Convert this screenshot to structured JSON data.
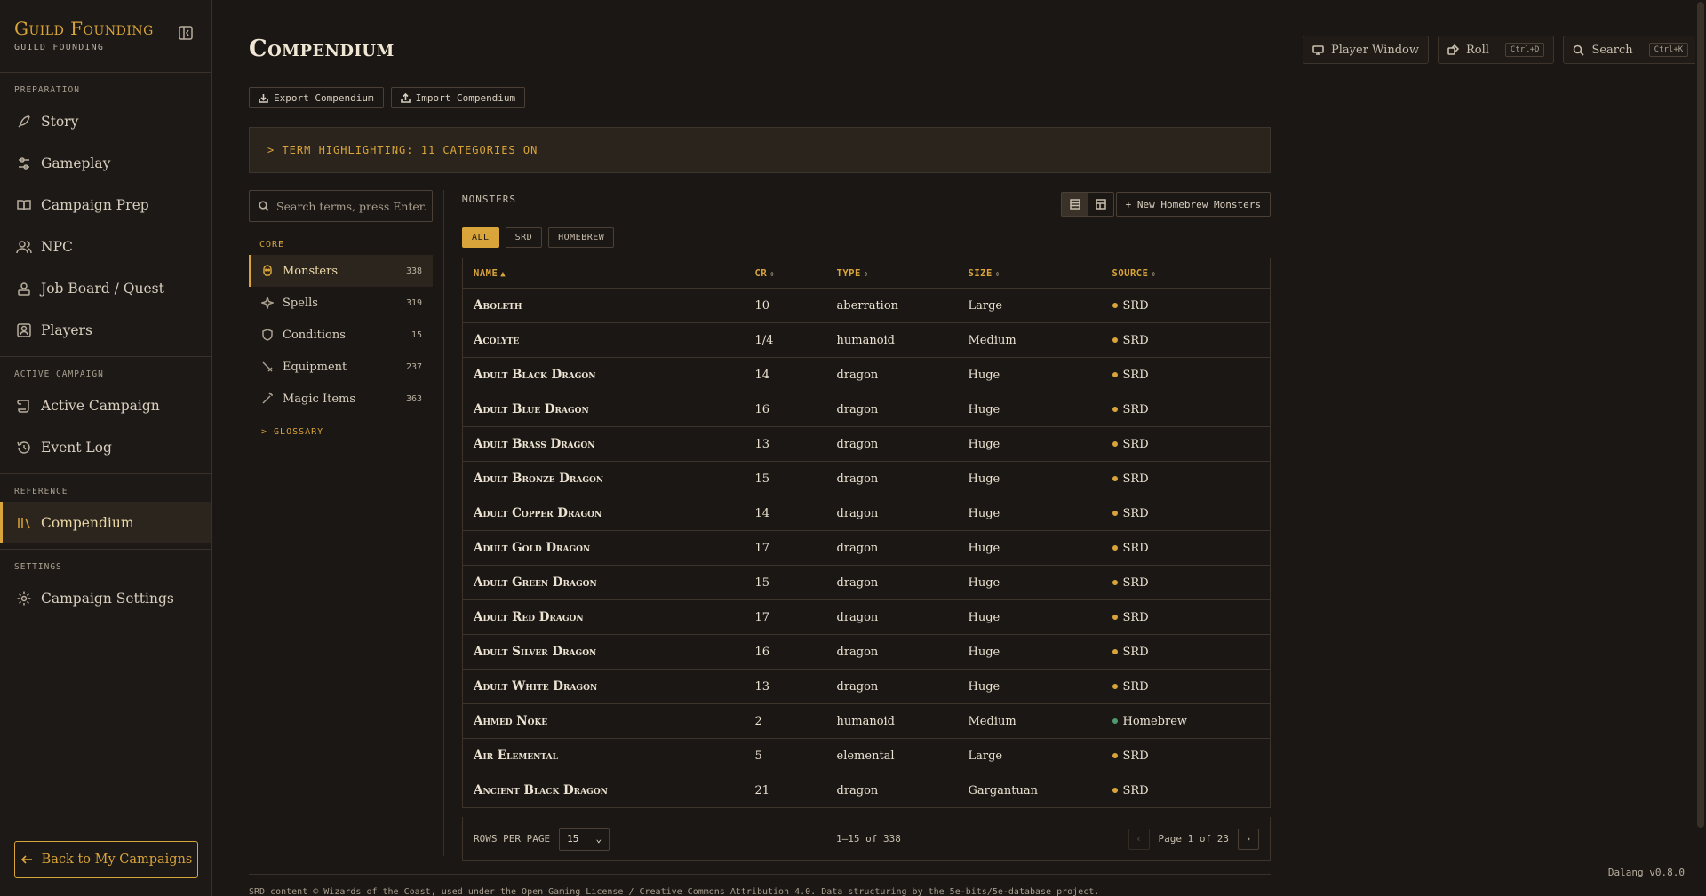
{
  "brand": {
    "title": "Guild Founding",
    "subtitle": "GUILD FOUNDING"
  },
  "sidebar": {
    "sections": [
      {
        "label": "PREPARATION",
        "items": [
          {
            "label": "Story",
            "icon": "feather-icon"
          },
          {
            "label": "Gameplay",
            "icon": "sliders-icon"
          },
          {
            "label": "Campaign Prep",
            "icon": "book-icon"
          },
          {
            "label": "NPC",
            "icon": "users-icon"
          },
          {
            "label": "Job Board / Quest",
            "icon": "quest-icon"
          },
          {
            "label": "Players",
            "icon": "player-icon"
          }
        ]
      },
      {
        "label": "ACTIVE CAMPAIGN",
        "items": [
          {
            "label": "Active Campaign",
            "icon": "scroll-icon"
          },
          {
            "label": "Event Log",
            "icon": "history-icon"
          }
        ]
      },
      {
        "label": "REFERENCE",
        "items": [
          {
            "label": "Compendium",
            "icon": "library-icon",
            "active": true
          }
        ]
      },
      {
        "label": "SETTINGS",
        "items": [
          {
            "label": "Campaign Settings",
            "icon": "gear-icon"
          }
        ]
      }
    ],
    "back_label": "Back to My Campaigns"
  },
  "header": {
    "title": "Compendium",
    "player_window": "Player Window",
    "roll": "Roll",
    "roll_kbd": "Ctrl+D",
    "search": "Search",
    "search_kbd": "Ctrl+K"
  },
  "io": {
    "export": "Export Compendium",
    "import": "Import Compendium"
  },
  "banner": "> TERM HIGHLIGHTING: 11 CATEGORIES ON",
  "categories": {
    "search_placeholder": "Search terms, press Enter...",
    "core_label": "CORE",
    "items": [
      {
        "label": "Monsters",
        "count": "338",
        "active": true
      },
      {
        "label": "Spells",
        "count": "319"
      },
      {
        "label": "Conditions",
        "count": "15"
      },
      {
        "label": "Equipment",
        "count": "237"
      },
      {
        "label": "Magic Items",
        "count": "363"
      }
    ],
    "glossary": "> GLOSSARY"
  },
  "table": {
    "section_label": "MONSTERS",
    "new_button": "+ New Homebrew Monsters",
    "filters": [
      "ALL",
      "SRD",
      "HOMEBREW"
    ],
    "columns": [
      "NAME",
      "CR",
      "TYPE",
      "SIZE",
      "SOURCE"
    ],
    "rows": [
      [
        "Aboleth",
        "10",
        "aberration",
        "Large",
        "SRD"
      ],
      [
        "Acolyte",
        "1/4",
        "humanoid",
        "Medium",
        "SRD"
      ],
      [
        "Adult Black Dragon",
        "14",
        "dragon",
        "Huge",
        "SRD"
      ],
      [
        "Adult Blue Dragon",
        "16",
        "dragon",
        "Huge",
        "SRD"
      ],
      [
        "Adult Brass Dragon",
        "13",
        "dragon",
        "Huge",
        "SRD"
      ],
      [
        "Adult Bronze Dragon",
        "15",
        "dragon",
        "Huge",
        "SRD"
      ],
      [
        "Adult Copper Dragon",
        "14",
        "dragon",
        "Huge",
        "SRD"
      ],
      [
        "Adult Gold Dragon",
        "17",
        "dragon",
        "Huge",
        "SRD"
      ],
      [
        "Adult Green Dragon",
        "15",
        "dragon",
        "Huge",
        "SRD"
      ],
      [
        "Adult Red Dragon",
        "17",
        "dragon",
        "Huge",
        "SRD"
      ],
      [
        "Adult Silver Dragon",
        "16",
        "dragon",
        "Huge",
        "SRD"
      ],
      [
        "Adult White Dragon",
        "13",
        "dragon",
        "Huge",
        "SRD"
      ],
      [
        "Ahmed Noke",
        "2",
        "humanoid",
        "Medium",
        "Homebrew"
      ],
      [
        "Air Elemental",
        "5",
        "elemental",
        "Large",
        "SRD"
      ],
      [
        "Ancient Black Dragon",
        "21",
        "dragon",
        "Gargantuan",
        "SRD"
      ]
    ],
    "source_colors": {
      "SRD": "#d9a43a",
      "Homebrew": "#4f9a6e"
    },
    "rows_per_page_label": "ROWS PER PAGE",
    "rows_per_page": "15",
    "range": "1–15 of 338",
    "page": "Page 1 of 23"
  },
  "license": "SRD content © Wizards of the Coast, used under the Open Gaming License / Creative Commons Attribution 4.0. Data structuring by the 5e-bits/5e-database project.",
  "version": "Dalang v0.8.0"
}
